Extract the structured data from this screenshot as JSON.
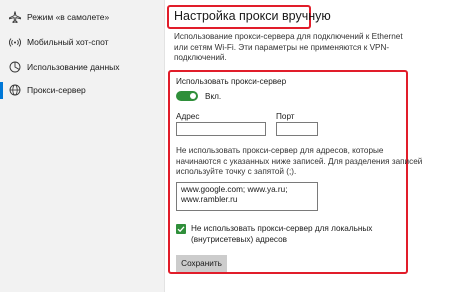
{
  "sidebar": {
    "items": [
      {
        "label": "Режим «в самолете»",
        "icon": "airplane-icon"
      },
      {
        "label": "Мобильный хот-спот",
        "icon": "hotspot-icon"
      },
      {
        "label": "Использование данных",
        "icon": "data-usage-icon"
      },
      {
        "label": "Прокси-сервер",
        "icon": "globe-icon",
        "active": true
      }
    ]
  },
  "main": {
    "title": "Настройка прокси вручную",
    "description": [
      "Использование прокси-сервера для подключений к Ethernet",
      "или сетям Wi-Fi. Эти параметры не применяются к VPN-",
      "подключений."
    ],
    "use_proxy_label": "Использовать прокси-сервер",
    "toggle_state": "Вкл.",
    "address_label": "Адрес",
    "address_value": "",
    "port_label": "Порт",
    "port_value": "",
    "exceptions_hint": [
      "Не использовать прокси-сервер для адресов, которые",
      "начинаются с указанных ниже записей. Для разделения записей",
      "используйте точку с запятой (;)."
    ],
    "exceptions_value": [
      "www.google.com; www.ya.ru;",
      "www.rambler.ru"
    ],
    "local_bypass_label": [
      "Не использовать прокси-сервер для локальных",
      "(внутрисетевых) адресов"
    ],
    "local_bypass_checked": true,
    "save_label": "Сохранить"
  },
  "colors": {
    "accent": "#0078d7",
    "toggle_on": "#2f8f3a",
    "highlight": "#e11d2a"
  }
}
